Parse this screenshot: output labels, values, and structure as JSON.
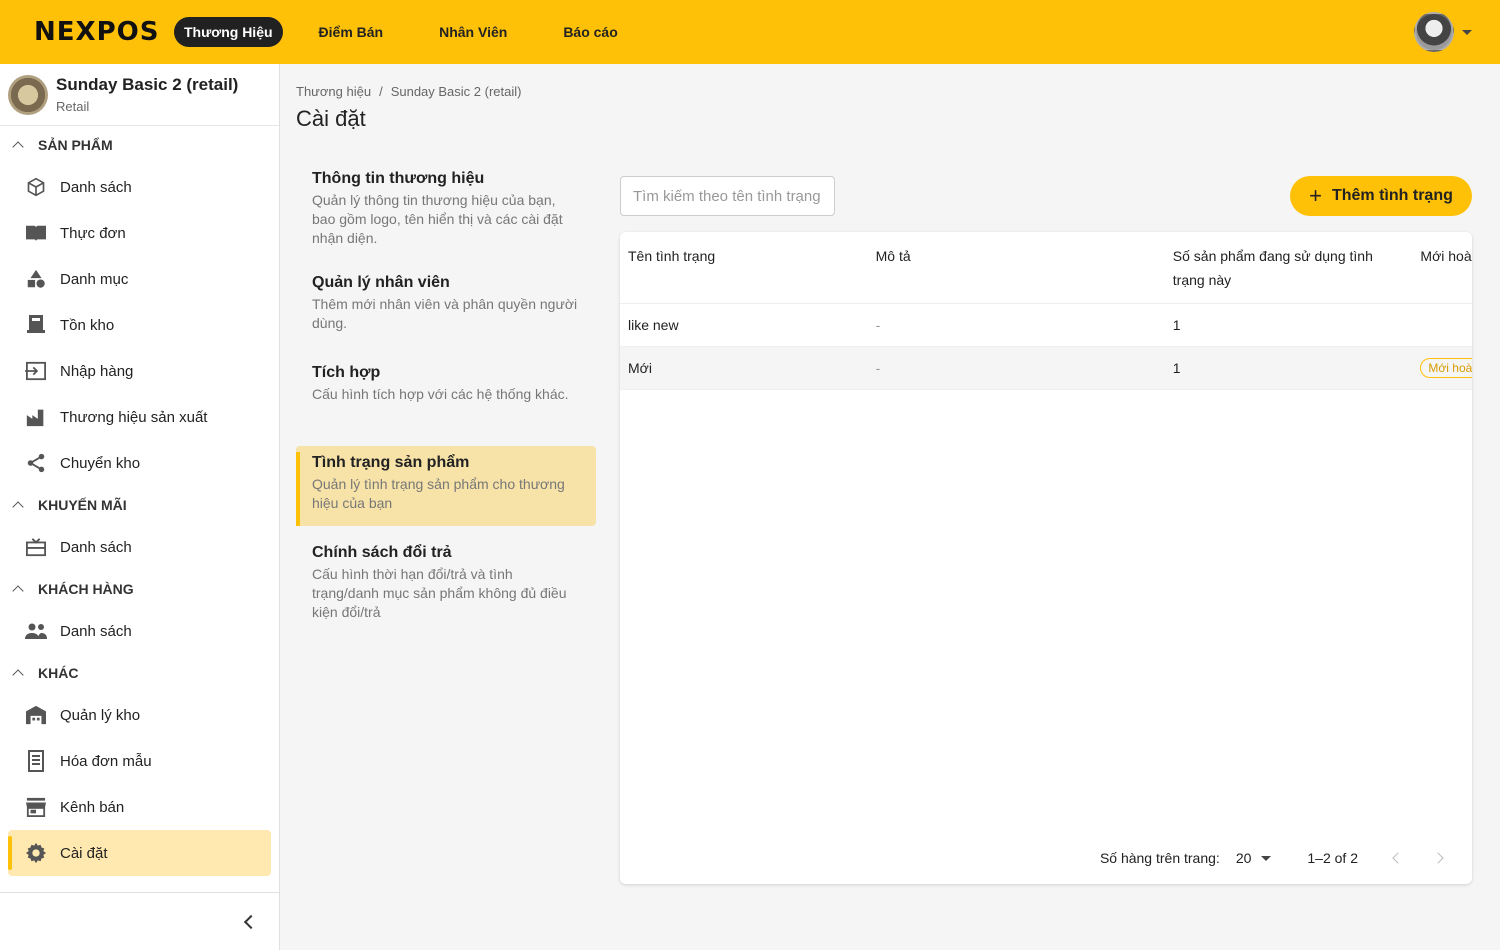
{
  "topbar": {
    "logo": "NEXPOS",
    "nav": [
      "Thương Hiệu",
      "Điểm Bán",
      "Nhân Viên",
      "Báo cáo"
    ],
    "active_nav": "Thương Hiệu"
  },
  "brand": {
    "name": "Sunday Basic 2 (retail)",
    "type": "Retail"
  },
  "sidebar": {
    "sections": [
      {
        "title": "SẢN PHẨM",
        "items": [
          {
            "label": "Danh sách",
            "icon": "cube-icon"
          },
          {
            "label": "Thực đơn",
            "icon": "menu-book-icon"
          },
          {
            "label": "Danh mục",
            "icon": "category-icon"
          },
          {
            "label": "Tồn kho",
            "icon": "inventory-icon"
          },
          {
            "label": "Nhập hàng",
            "icon": "import-icon"
          },
          {
            "label": "Thương hiệu sản xuất",
            "icon": "factory-icon"
          },
          {
            "label": "Chuyển kho",
            "icon": "share-icon"
          }
        ]
      },
      {
        "title": "KHUYẾN MÃI",
        "items": [
          {
            "label": "Danh sách",
            "icon": "gift-card-icon"
          }
        ]
      },
      {
        "title": "KHÁCH HÀNG",
        "items": [
          {
            "label": "Danh sách",
            "icon": "people-icon"
          }
        ]
      },
      {
        "title": "KHÁC",
        "items": [
          {
            "label": "Quản lý kho",
            "icon": "warehouse-icon"
          },
          {
            "label": "Hóa đơn mẫu",
            "icon": "receipt-icon"
          },
          {
            "label": "Kênh bán",
            "icon": "store-icon"
          },
          {
            "label": "Cài đặt",
            "icon": "gear-icon"
          }
        ]
      }
    ]
  },
  "breadcrumb": [
    "Thương hiệu",
    "Sunday Basic 2 (retail)"
  ],
  "page_title": "Cài đặt",
  "settings_nav": [
    {
      "title": "Thông tin thương hiệu",
      "desc": "Quản lý thông tin thương hiệu của bạn, bao gồm logo, tên hiển thị và các cài đặt nhận diện."
    },
    {
      "title": "Quản lý nhân viên",
      "desc": "Thêm mới nhân viên và phân quyền người dùng."
    },
    {
      "title": "Tích hợp",
      "desc": "Cấu hình tích hợp với các hệ thống khác."
    },
    {
      "title": "Tình trạng sản phẩm",
      "desc": "Quản lý tình trạng sản phẩm cho thương hiệu của bạn"
    },
    {
      "title": "Chính sách đổi trả",
      "desc": "Cấu hình thời hạn đổi/trả và tình trạng/danh mục sản phẩm không đủ điều kiện đổi/trả"
    }
  ],
  "search": {
    "placeholder": "Tìm kiếm theo tên tình trạng"
  },
  "add_button": "Thêm tình trạng",
  "table": {
    "headers": [
      "Tên tình trạng",
      "Mô tả",
      "Số sản phẩm đang sử dụng tình trạng này",
      "Mới hoàn toàn"
    ],
    "rows": [
      {
        "name": "like new",
        "desc": "-",
        "count": "1",
        "badge": ""
      },
      {
        "name": "Mới",
        "desc": "-",
        "count": "1",
        "badge": "Mới hoàn toàn"
      }
    ]
  },
  "pagination": {
    "rows_per_page_label": "Số hàng trên trang:",
    "rows_per_page": "20",
    "range": "1–2 of 2"
  },
  "colors": {
    "accent": "#FFC107",
    "active_bg": "#FFE9B0"
  }
}
